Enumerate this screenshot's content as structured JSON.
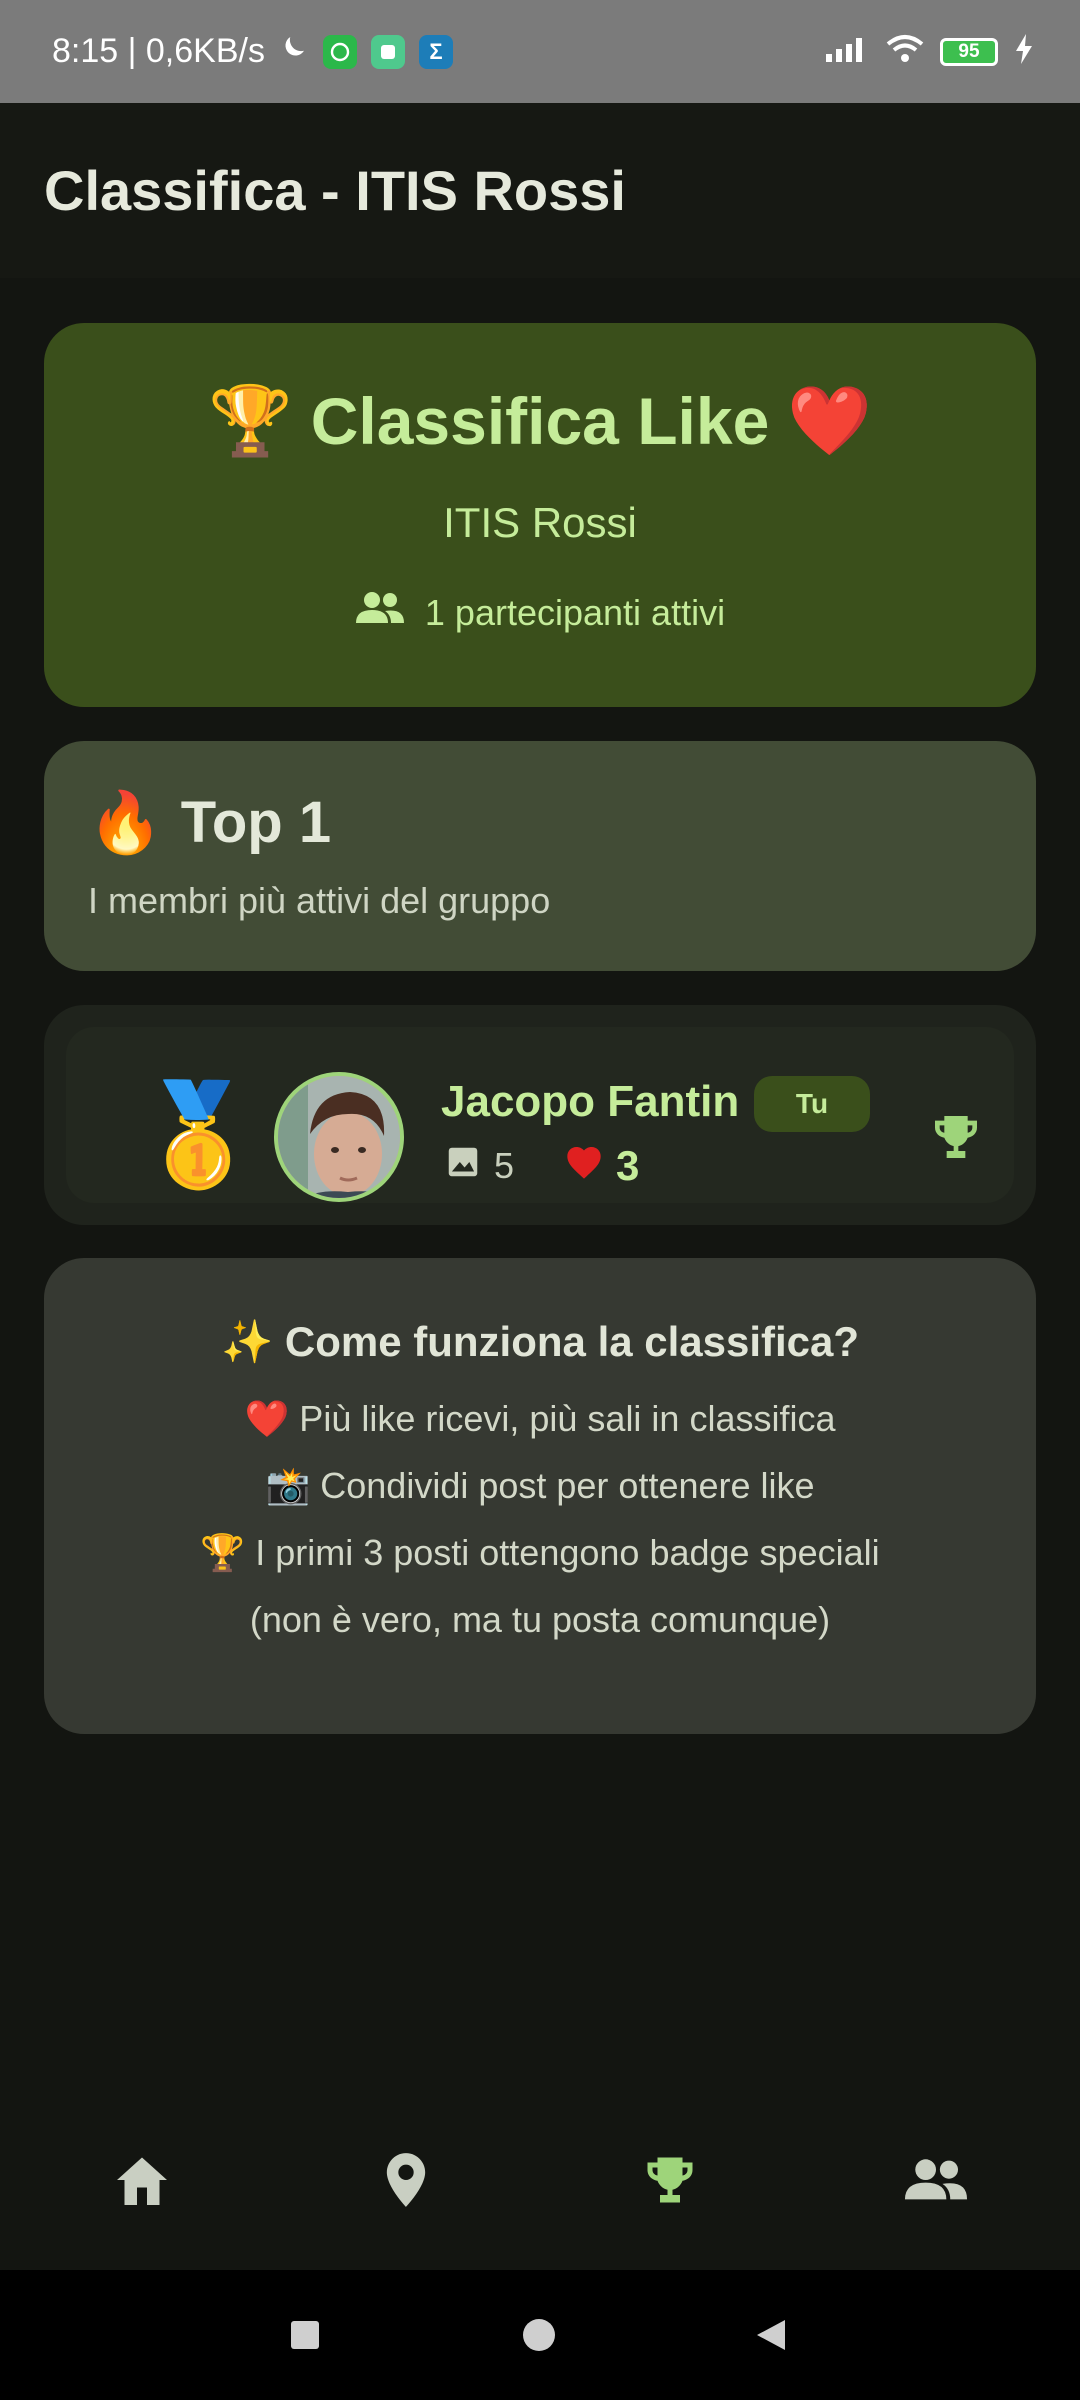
{
  "status_bar": {
    "time_speed": "8:15 | 0,6KB/s",
    "battery": "95",
    "icons": [
      "moon-icon",
      "whatsapp-icon",
      "app-icon",
      "sigma-icon",
      "signal-icon",
      "wifi-icon",
      "battery-icon",
      "charging-icon"
    ]
  },
  "app_bar": {
    "title": "Classifica - ITIS Rossi"
  },
  "hero": {
    "title": "Classifica Like",
    "title_emoji_left": "🏆",
    "title_emoji_right": "❤️",
    "subtitle": "ITIS Rossi",
    "participants": "1 partecipanti attivi"
  },
  "top_section": {
    "emoji": "🔥",
    "title": "Top 1",
    "subtitle": "I membri più attivi del gruppo"
  },
  "leaderboard": [
    {
      "medal": "🥇",
      "name": "Jacopo Fantin",
      "badge": "Tu",
      "posts": "5",
      "likes": "3"
    }
  ],
  "info": {
    "title": "✨ Come funziona la classifica?",
    "lines": [
      "❤️ Più like ricevi, più sali in classifica",
      "📸 Condividi post per ottenere like",
      "🏆 I primi 3 posti ottengono badge speciali",
      "(non è vero, ma tu posta comunque)"
    ]
  },
  "bottom_nav": {
    "items": [
      "home-icon",
      "location-icon",
      "trophy-icon",
      "people-icon"
    ],
    "active": "trophy-icon"
  },
  "colors": {
    "background": "#131511",
    "accent_green": "#c5ec9a",
    "hero_card": "#3a4f1b",
    "heart_red": "#e02020"
  }
}
